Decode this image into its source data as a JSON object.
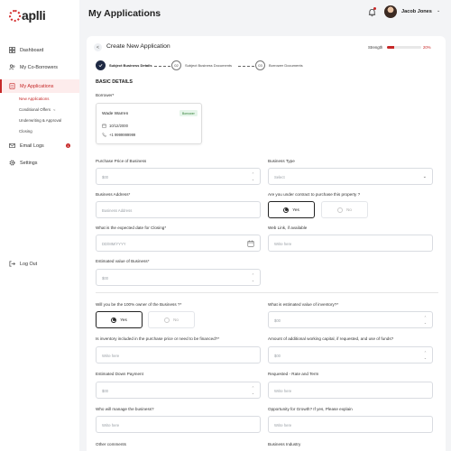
{
  "app": {
    "brand": "aplli"
  },
  "sidebar": {
    "items": [
      {
        "label": "Dashboard"
      },
      {
        "label": "My Co-Borrowers"
      },
      {
        "label": "My Applications"
      },
      {
        "label": "Email Logs",
        "badge": "1"
      },
      {
        "label": "Settings"
      }
    ],
    "sub_items": [
      {
        "label": "New Applications"
      },
      {
        "label": "Conditional Offers"
      },
      {
        "label": "Underwriting & Approval"
      },
      {
        "label": "Closing"
      }
    ],
    "logout": "Log Out"
  },
  "header": {
    "title": "My Applications",
    "user_name": "Jacob Jones"
  },
  "form": {
    "title": "Create New Application",
    "strength_label": "Strength",
    "strength_value": "20%",
    "strength_fraction": 0.2,
    "steps": [
      {
        "num": "",
        "label": "Subject Business Details"
      },
      {
        "num": "02",
        "label": "Subject Business Documents"
      },
      {
        "num": "03",
        "label": "Borrower Documents"
      }
    ],
    "section": "BASIC DETAILS",
    "borrower_label": "Borrower*",
    "borrower": {
      "name": "Wade Warren",
      "tag": "Borrower",
      "dob": "10/12/2000",
      "phone": "+1 9999999999"
    },
    "fields": {
      "purchase_price": {
        "label": "Purchase Price of Business",
        "placeholder": "$00"
      },
      "business_type": {
        "label": "Business Type",
        "placeholder": "Select"
      },
      "business_address": {
        "label": "Business Address*",
        "placeholder": "Business Address"
      },
      "under_contract": {
        "label": "Are you under contract to purchase this property ?",
        "yes": "Yes",
        "no": "No"
      },
      "closing_date": {
        "label": "What is the expected date for Closing*",
        "placeholder": "DD/MM/YYYY"
      },
      "web_link": {
        "label": "Web Link, if available",
        "placeholder": "Write here"
      },
      "estimated_value": {
        "label": "Estimated value of Business*",
        "placeholder": "$00"
      },
      "owner_100": {
        "label": "Will you be the 100% owner of the Business ?*",
        "yes": "Yes",
        "no": "No"
      },
      "inventory_value": {
        "label": "What is estimated value of inventory?*",
        "placeholder": "$00"
      },
      "inventory_included": {
        "label": "Is inventory included in the purchase price or need to be financed?*",
        "placeholder": "Write here"
      },
      "working_capital": {
        "label": "Amount of additional working capital, if requested, and use of funds?",
        "placeholder": "$00"
      },
      "down_payment": {
        "label": "Estimated Down Payment",
        "placeholder": "$00"
      },
      "rate_term": {
        "label": "Requested - Rate and Term",
        "placeholder": "Write here"
      },
      "manage_business": {
        "label": "Who will manage the business?",
        "placeholder": "Write here"
      },
      "growth": {
        "label": "Opportunity for Growth? If yes, Please explain",
        "placeholder": "Write here"
      },
      "other_comments": {
        "label": "Other comments"
      },
      "business_industry": {
        "label": "Business Industry"
      }
    }
  }
}
